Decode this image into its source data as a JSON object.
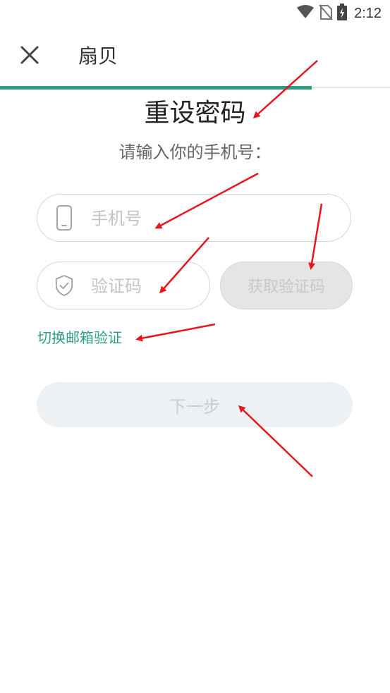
{
  "status_bar": {
    "time": "2:12",
    "icons": [
      "wifi-icon",
      "no-sim-icon",
      "battery-charging-icon"
    ]
  },
  "app_bar": {
    "title": "扇贝",
    "close_icon": "close-icon"
  },
  "progress": {
    "fraction": 0.8,
    "color": "#2e9c83"
  },
  "form": {
    "title": "重设密码",
    "subtitle": "请输入你的手机号：",
    "phone_field": {
      "icon": "phone-icon",
      "placeholder": "手机号",
      "value": ""
    },
    "code_field": {
      "icon": "shield-check-icon",
      "placeholder": "验证码",
      "value": ""
    },
    "get_code_label": "获取验证码",
    "switch_label": "切换邮箱验证",
    "next_label": "下一步"
  },
  "colors": {
    "accent": "#2e9c83",
    "annotation_arrow": "#e8161c",
    "disabled_button": "#e5e5e5"
  }
}
